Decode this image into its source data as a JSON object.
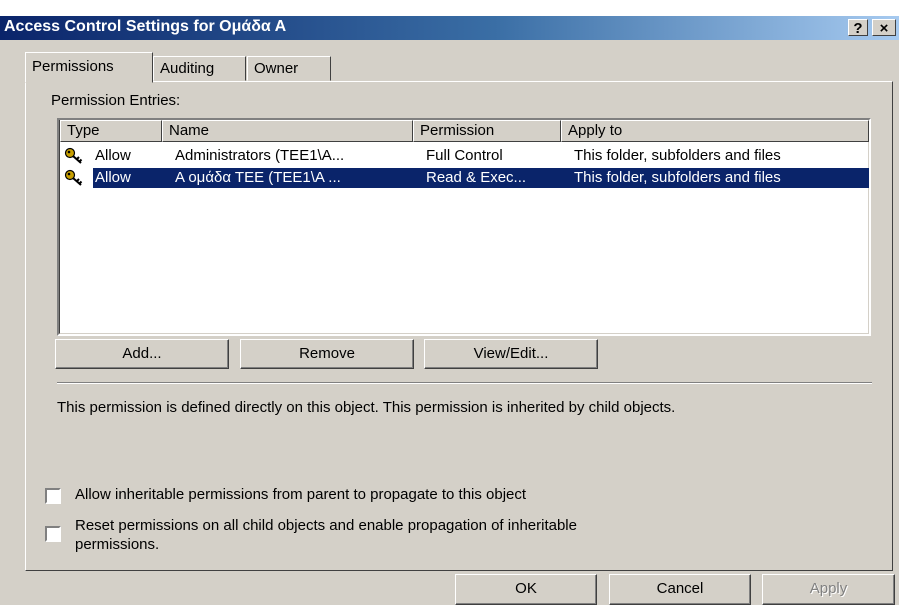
{
  "window": {
    "title": "Access Control Settings for Ομάδα Α",
    "help_button": "?",
    "close_button": "×"
  },
  "tabs": [
    {
      "label": "Permissions",
      "active": true
    },
    {
      "label": "Auditing",
      "active": false
    },
    {
      "label": "Owner",
      "active": false
    }
  ],
  "permissions": {
    "entries_label": "Permission Entries:",
    "columns": [
      "Type",
      "Name",
      "Permission",
      "Apply to"
    ],
    "rows": [
      {
        "type": "Allow",
        "name": "Administrators (TEE1\\A...",
        "permission": "Full Control",
        "apply_to": "This folder, subfolders and files",
        "selected": false,
        "icon": "key-icon"
      },
      {
        "type": "Allow",
        "name": "Α ομάδα ΤΕΕ (TEE1\\A ...",
        "permission": "Read & Exec...",
        "apply_to": "This folder, subfolders and files",
        "selected": true,
        "icon": "key-icon"
      }
    ],
    "buttons": {
      "add": "Add...",
      "remove": "Remove",
      "view_edit": "View/Edit..."
    },
    "description": "This permission is defined directly on this object. This permission is inherited by child objects.",
    "checkbox_inherit": {
      "label": "Allow inheritable permissions from parent to propagate to this object",
      "checked": false
    },
    "checkbox_reset": {
      "label_line1": "Reset permissions on all child objects and enable propagation of inheritable",
      "label_line2": "permissions.",
      "checked": false
    }
  },
  "footer": {
    "ok": "OK",
    "cancel": "Cancel",
    "apply": "Apply",
    "apply_disabled": true
  },
  "colors": {
    "titlebar_start": "#0a246a",
    "titlebar_end": "#a6caf0",
    "dialog_bg": "#d4d0c8",
    "selection": "#0a246a"
  }
}
